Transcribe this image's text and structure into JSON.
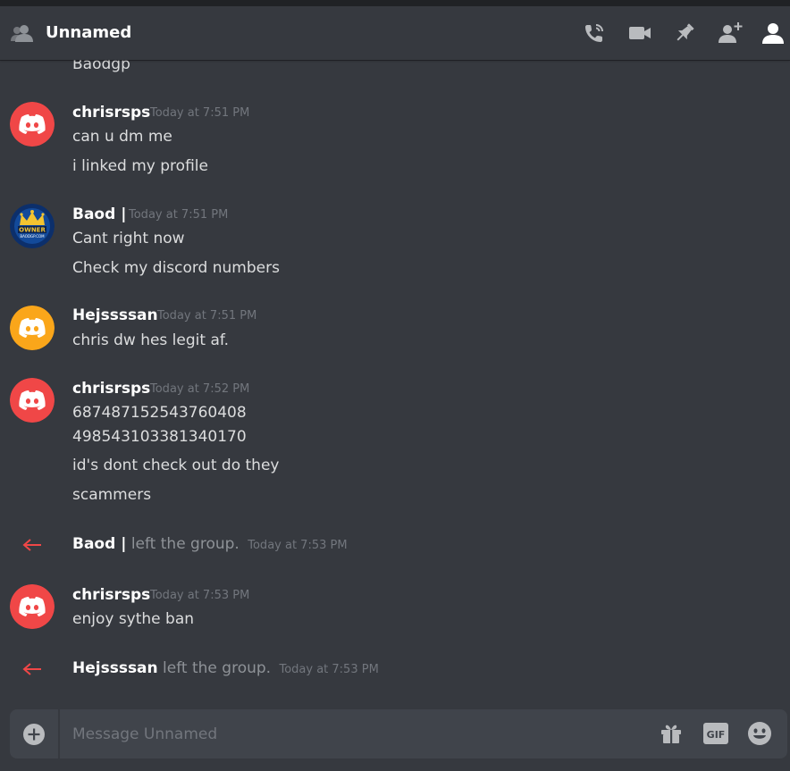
{
  "header": {
    "title": "Unnamed",
    "icons": [
      "group-icon",
      "voice-call-icon",
      "video-call-icon",
      "pin-icon",
      "add-friend-icon",
      "member-list-icon"
    ]
  },
  "messages": [
    {
      "type": "continuation",
      "lines": [
        "Baodgp"
      ]
    },
    {
      "type": "message",
      "author": "chrisrsps",
      "timestamp": "Today at 7:51 PM",
      "avatar_color": "#f04747",
      "lines": [
        "can u dm me",
        "i linked my profile"
      ]
    },
    {
      "type": "message",
      "author": "Baod |",
      "timestamp": "Today at 7:51 PM",
      "avatar_text": "OWNER",
      "avatar_subtext": "BAODGP.COM",
      "lines": [
        "Cant right now",
        "Check my discord numbers"
      ]
    },
    {
      "type": "message",
      "author": "Hejssssan",
      "timestamp": "Today at 7:51 PM",
      "avatar_color": "#faa61a",
      "lines": [
        "chris dw hes legit af."
      ]
    },
    {
      "type": "message",
      "author": "chrisrsps",
      "timestamp": "Today at 7:52 PM",
      "avatar_color": "#f04747",
      "lines": [
        "687487152543760408",
        "498543103381340170",
        "id's dont check out do they",
        "scammers"
      ]
    },
    {
      "type": "system",
      "who": "Baod |",
      "action": "left the group.",
      "timestamp": "Today at 7:53 PM"
    },
    {
      "type": "message",
      "author": "chrisrsps",
      "timestamp": "Today at 7:53 PM",
      "avatar_color": "#f04747",
      "lines": [
        "enjoy sythe ban"
      ]
    },
    {
      "type": "system",
      "who": "Hejssssan",
      "action": "left the group.",
      "timestamp": "Today at 7:53 PM"
    }
  ],
  "composer": {
    "placeholder": "Message Unnamed",
    "value": "",
    "gif_label": "GIF",
    "icons": [
      "add-attachment-icon",
      "gift-icon",
      "gif-icon",
      "emoji-icon"
    ]
  },
  "colors": {
    "background": "#36393f",
    "composer": "#40444b",
    "red_avatar": "#f04747",
    "orange_avatar": "#faa61a",
    "system_arrow": "#f04747",
    "timestamp": "#72767d"
  }
}
